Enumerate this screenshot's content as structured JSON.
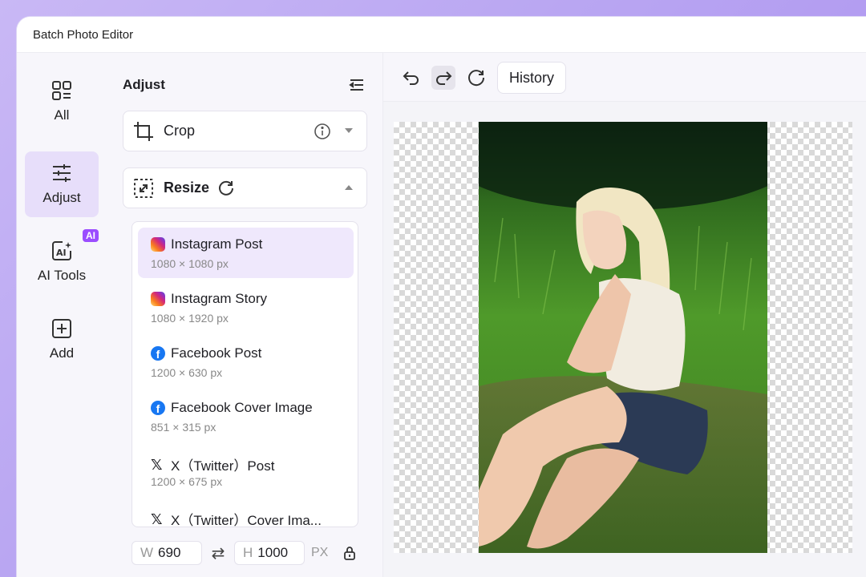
{
  "window": {
    "title": "Batch Photo Editor"
  },
  "rail": {
    "items": [
      {
        "label": "All",
        "icon": "grid-icon",
        "active": false
      },
      {
        "label": "Adjust",
        "icon": "sliders-icon",
        "active": true
      },
      {
        "label": "AI Tools",
        "icon": "ai-icon",
        "active": false,
        "badge": "AI"
      },
      {
        "label": "Add",
        "icon": "plus-box-icon",
        "active": false
      }
    ]
  },
  "panel": {
    "title": "Adjust",
    "crop": {
      "label": "Crop"
    },
    "resize": {
      "label": "Resize"
    },
    "presets": [
      {
        "name": "Instagram Post",
        "size": "1080 × 1080 px",
        "platform": "instagram",
        "selected": true
      },
      {
        "name": "Instagram Story",
        "size": "1080 × 1920 px",
        "platform": "instagram",
        "selected": false
      },
      {
        "name": "Facebook Post",
        "size": "1200 × 630 px",
        "platform": "facebook",
        "selected": false
      },
      {
        "name": "Facebook Cover Image",
        "size": "851 × 315 px",
        "platform": "facebook",
        "selected": false
      },
      {
        "name": "X（Twitter）Post",
        "size": "1200 × 675 px",
        "platform": "x",
        "selected": false
      },
      {
        "name": "X（Twitter）Cover Ima...",
        "size": "",
        "platform": "x",
        "selected": false
      }
    ],
    "width": {
      "key": "W",
      "value": "690"
    },
    "height": {
      "key": "H",
      "value": "1000"
    },
    "unit": "PX"
  },
  "toolbar": {
    "history_label": "History"
  },
  "colors": {
    "accent": "#9b4dff",
    "selected": "#efe8fc",
    "railActive": "#e7defa"
  }
}
